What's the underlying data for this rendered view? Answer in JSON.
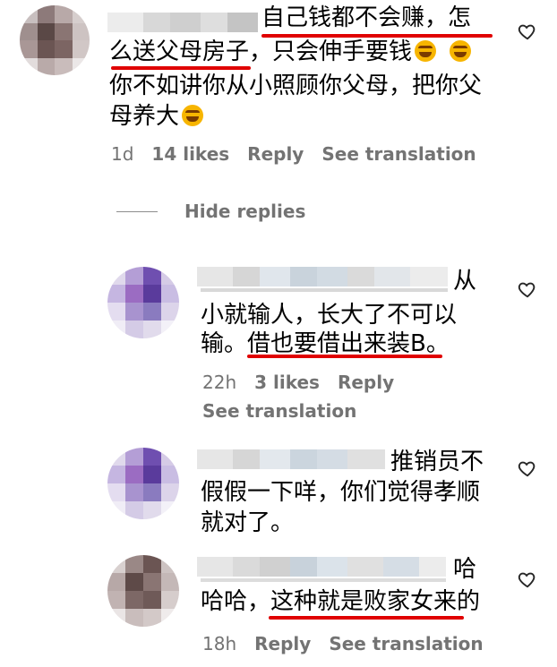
{
  "comments": [
    {
      "lines": [
        "自己钱都不会赚，怎",
        "么送父母房子，只会伸手要钱",
        "你不如讲你从小照顾你父母，把你父",
        "母养大"
      ],
      "meta": {
        "time": "1d",
        "likes": "14 likes",
        "reply": "Reply",
        "translation": "See translation"
      }
    }
  ],
  "hide_replies": "Hide replies",
  "replies": [
    {
      "lines": [
        "从",
        "小就输人，长大了不可以",
        "输。借也要借出来装B。"
      ],
      "meta": {
        "time": "22h",
        "likes": "3 likes",
        "reply": "Reply",
        "translation": "See translation"
      }
    },
    {
      "lines": [
        "推销员不",
        "假假一下咩，你们觉得孝顺",
        "就对了。"
      ]
    },
    {
      "lines": [
        "哈",
        "哈哈，这种就是败家女来的"
      ],
      "meta": {
        "time": "18h",
        "reply": "Reply",
        "translation": "See translation"
      }
    }
  ],
  "colors": {
    "underline": "#e00000",
    "meta_text": "#737373",
    "emoji": "#f7b500"
  },
  "icons": {
    "like": "heart-outline-icon",
    "emoji": "rolling-on-floor-laughing-icon"
  }
}
